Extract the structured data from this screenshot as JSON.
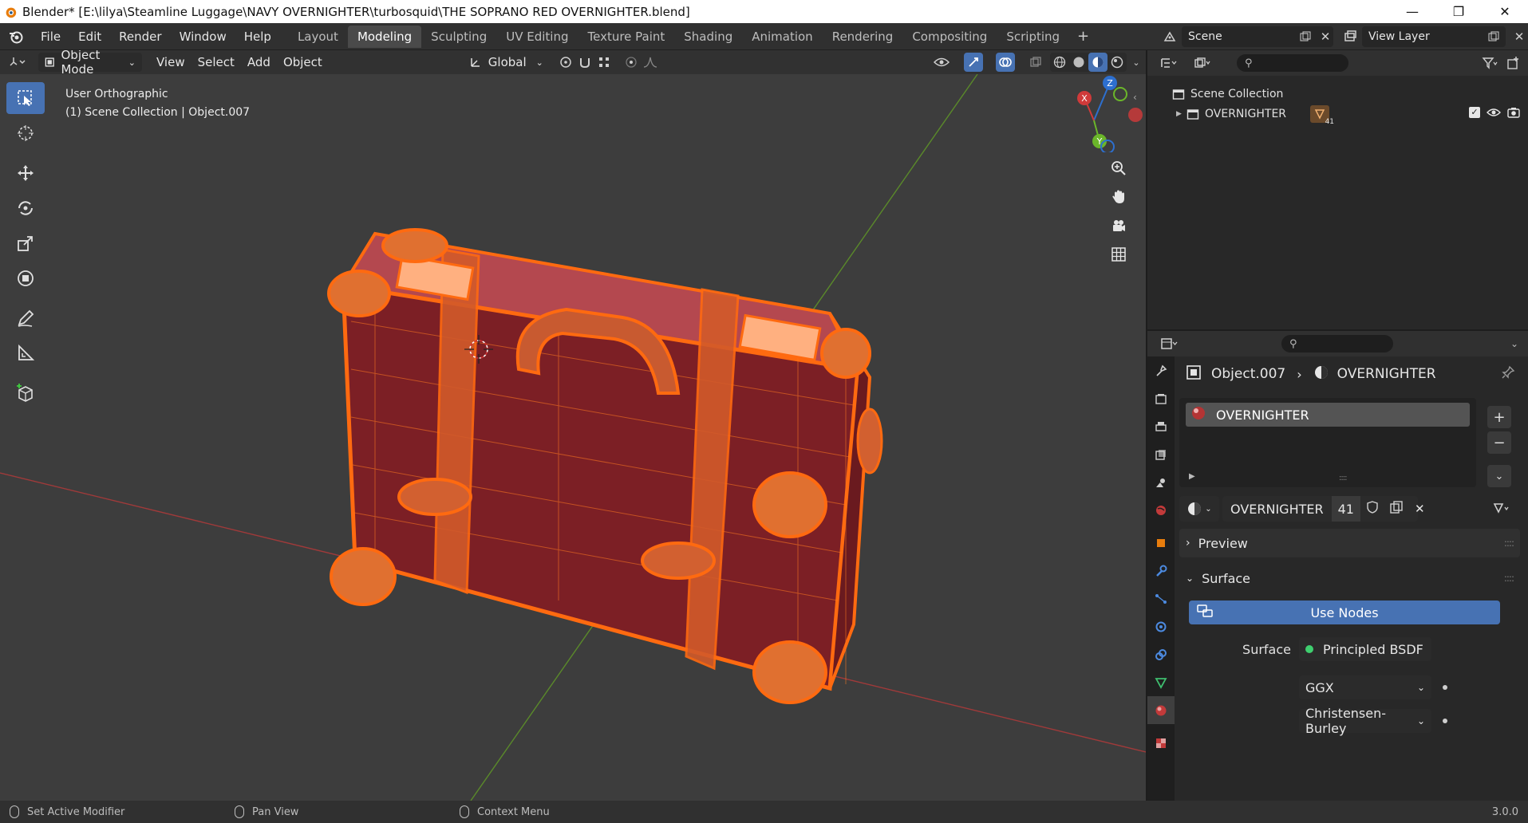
{
  "window": {
    "title": "Blender* [E:\\lilya\\Steamline Luggage\\NAVY OVERNIGHTER\\turbosquid\\THE SOPRANO RED OVERNIGHTER.blend]",
    "minimize": "—",
    "maximize": "❐",
    "close": "✕"
  },
  "menu": {
    "items": [
      "File",
      "Edit",
      "Render",
      "Window",
      "Help"
    ]
  },
  "workspaces": {
    "tabs": [
      "Layout",
      "Modeling",
      "Sculpting",
      "UV Editing",
      "Texture Paint",
      "Shading",
      "Animation",
      "Rendering",
      "Compositing",
      "Scripting"
    ],
    "active": "Modeling",
    "add": "+"
  },
  "scene": {
    "scene_name": "Scene",
    "view_layer": "View Layer"
  },
  "viewport": {
    "mode": "Object Mode",
    "menus": [
      "View",
      "Select",
      "Add",
      "Object"
    ],
    "transform_orientation": "Global",
    "view_name": "User Orthographic",
    "collection_info": "(1) Scene Collection | Object.007",
    "accent": "#4772b3"
  },
  "gizmo": {
    "x": "X",
    "y": "Y",
    "z": "Z"
  },
  "outliner": {
    "root": "Scene Collection",
    "item": "OVERNIGHTER",
    "badge": "41"
  },
  "properties": {
    "object_name": "Object.007",
    "material_name": "OVERNIGHTER",
    "slot_label": "OVERNIGHTER",
    "users_count": "41",
    "preview_label": "Preview",
    "surface_panel_label": "Surface",
    "use_nodes_label": "Use Nodes",
    "surface_label": "Surface",
    "surface_value": "Principled BSDF",
    "distribution_value": "GGX",
    "subsurface_value": "Christensen-Burley"
  },
  "statusbar": {
    "left": "Set Active Modifier",
    "middle": "Pan View",
    "right": "Context Menu",
    "version": "3.0.0"
  }
}
